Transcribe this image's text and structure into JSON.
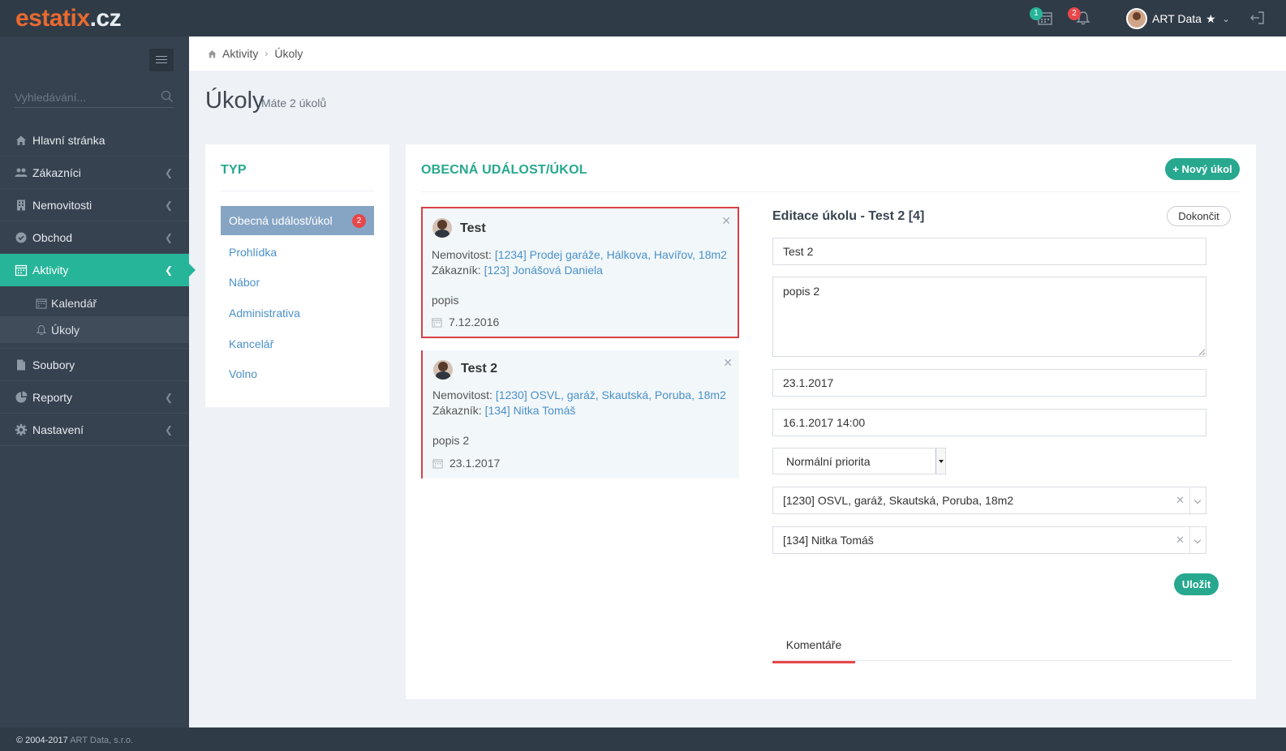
{
  "app": {
    "logo_main": "estatix",
    "logo_tld": ".cz",
    "calendar_badge": "1",
    "notify_badge": "2",
    "calendar_badge_color": "#27b59a",
    "notify_badge_color": "#e8474a",
    "user_name": "ART Data",
    "footer_year": "© 2004-2017",
    "footer_company": "ART Data, s.r.o."
  },
  "sidebar": {
    "search_placeholder": "Vyhledávání...",
    "items": [
      {
        "label": "Hlavní stránka",
        "icon": "home-icon"
      },
      {
        "label": "Zákazníci",
        "icon": "users-icon"
      },
      {
        "label": "Nemovitosti",
        "icon": "building-icon"
      },
      {
        "label": "Obchod",
        "icon": "check-circle-icon"
      },
      {
        "label": "Aktivity",
        "icon": "calendar-icon"
      },
      {
        "label": "Soubory",
        "icon": "file-icon"
      },
      {
        "label": "Reporty",
        "icon": "chart-icon"
      },
      {
        "label": "Nastavení",
        "icon": "gear-icon"
      }
    ],
    "subitems": [
      {
        "label": "Kalendář",
        "icon": "calendar-small-icon"
      },
      {
        "label": "Úkoly",
        "icon": "bell-icon"
      }
    ]
  },
  "breadcrumb": {
    "root": "Aktivity",
    "current": "Úkoly"
  },
  "page": {
    "title": "Úkoly",
    "subtitle": "Máte 2 úkolů"
  },
  "type_panel": {
    "heading": "TYP",
    "items": [
      {
        "label": "Obecná událost/úkol",
        "badge": "2"
      },
      {
        "label": "Prohlídka"
      },
      {
        "label": "Nábor"
      },
      {
        "label": "Administrativa"
      },
      {
        "label": "Kancelář"
      },
      {
        "label": "Volno"
      }
    ]
  },
  "main": {
    "heading": "OBECNÁ UDÁLOST/ÚKOL",
    "new_button": "Nový úkol",
    "tasks": [
      {
        "title": "Test",
        "property_label": "Nemovitost:",
        "property_value": "[1234] Prodej garáže, Hálkova, Havířov, 18m2",
        "customer_label": "Zákazník:",
        "customer_value": "[123] Jonášová Daniela",
        "description": "popis",
        "date": "7.12.2016"
      },
      {
        "title": "Test 2",
        "property_label": "Nemovitost:",
        "property_value": "[1230] OSVL, garáž, Skautská, Poruba, 18m2",
        "customer_label": "Zákazník:",
        "customer_value": "[134] Nitka Tomáš",
        "description": "popis 2",
        "date": "23.1.2017"
      }
    ],
    "edit": {
      "title": "Editace úkolu - Test 2 [4]",
      "done_button": "Dokončit",
      "name_value": "Test 2",
      "description_value": "popis 2",
      "deadline_value": "23.1.2017",
      "reminder_value": "16.1.2017 14:00",
      "priority_value": "Normální priorita",
      "property_value": "[1230] OSVL, garáž, Skautská, Poruba, 18m2",
      "customer_value": "[134] Nitka Tomáš",
      "save_button": "Uložit",
      "tab_comments": "Komentáře"
    }
  }
}
